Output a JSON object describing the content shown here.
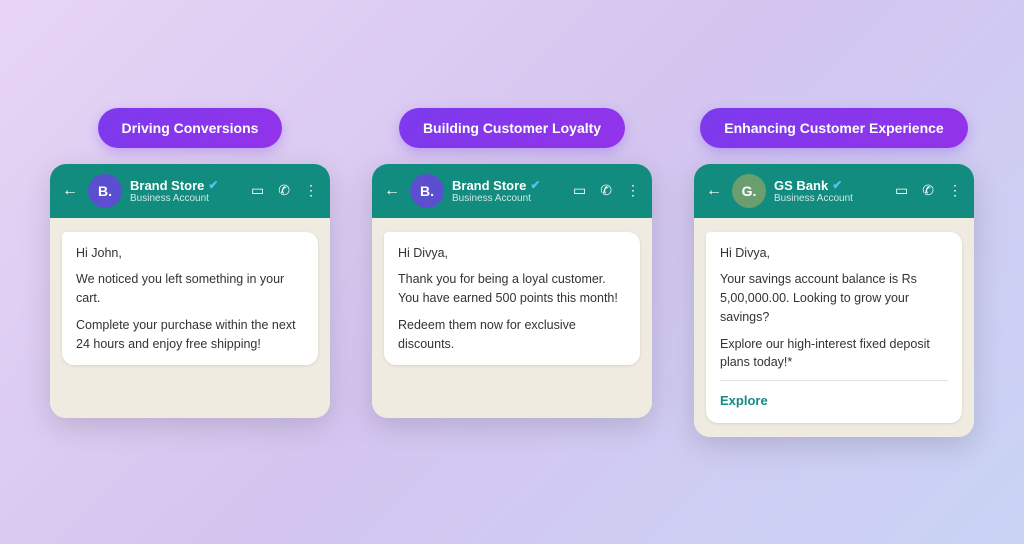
{
  "cards": [
    {
      "id": "driving-conversions",
      "pill": "Driving Conversions",
      "header": {
        "avatar_letter": "B.",
        "avatar_class": "avatar-brand",
        "name": "Brand Store",
        "sub": "Business Account"
      },
      "messages": [
        "Hi John,",
        "We noticed you left something in your cart.",
        "Complete your purchase within the next 24 hours and enjoy free shipping!"
      ],
      "explore": null
    },
    {
      "id": "building-loyalty",
      "pill": "Building Customer Loyalty",
      "header": {
        "avatar_letter": "B.",
        "avatar_class": "avatar-brand",
        "name": "Brand Store",
        "sub": "Business Account"
      },
      "messages": [
        "Hi Divya,",
        "Thank you for being a loyal customer. You have earned 500 points this month!",
        "Redeem them now for exclusive discounts."
      ],
      "explore": null
    },
    {
      "id": "enhancing-experience",
      "pill": "Enhancing Customer Experience",
      "header": {
        "avatar_letter": "G.",
        "avatar_class": "avatar-gs",
        "name": "GS Bank",
        "sub": "Business Account"
      },
      "messages": [
        "Hi Divya,",
        "Your savings account balance is Rs 5,00,000.00. Looking to grow your savings?",
        "Explore our high-interest fixed deposit plans today!*"
      ],
      "explore": "Explore"
    }
  ],
  "icons": {
    "back": "←",
    "video": "□",
    "phone": "📞",
    "more": "⋮",
    "verified": "✔"
  }
}
